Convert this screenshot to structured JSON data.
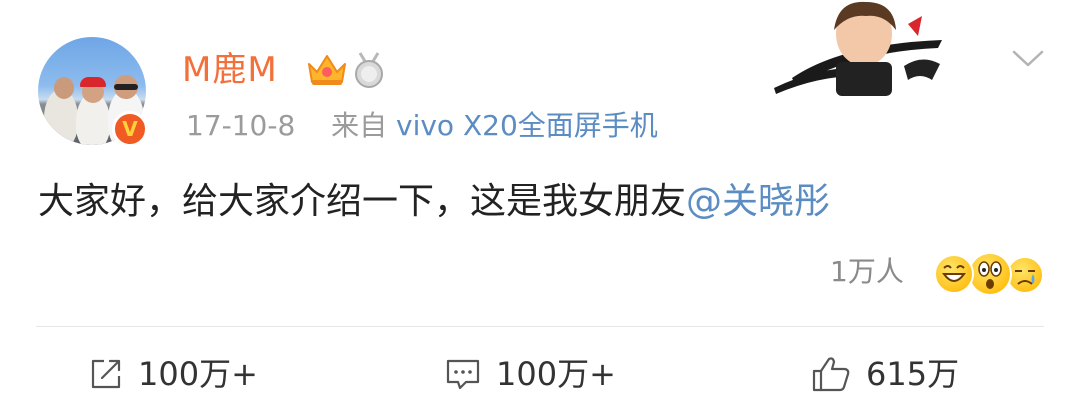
{
  "post": {
    "username": "M鹿M",
    "date": "17-10-8",
    "source_prefix": "来自",
    "source": "vivo X20全面屏手机",
    "text": "大家好，给大家介绍一下，这是我女朋友",
    "mention": "@关晓彤",
    "reaction_count": "1万人",
    "verified_mark": "V"
  },
  "actions": {
    "repost_count": "100万+",
    "comment_count": "100万+",
    "like_count": "615万"
  },
  "colors": {
    "username": "#f4703a",
    "link": "#5b8cc2",
    "meta": "#9b9b9b",
    "text": "#222222"
  },
  "icons": [
    "crown-badge-icon",
    "medal-badge-icon",
    "chevron-down-icon",
    "share-icon",
    "comment-icon",
    "thumbs-up-icon"
  ]
}
